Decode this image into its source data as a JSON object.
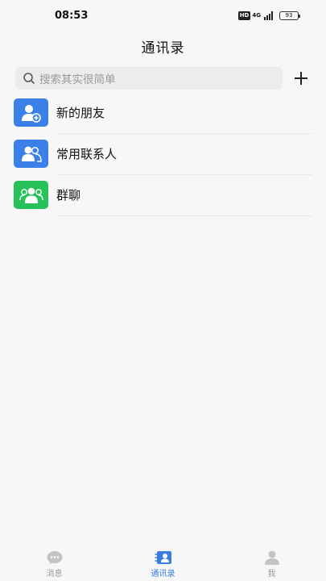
{
  "status_bar": {
    "time": "08:53",
    "hd_badge": "HD",
    "network": "4G",
    "battery": "93"
  },
  "header": {
    "title": "通讯录"
  },
  "search": {
    "placeholder": "搜索其实很简单",
    "add_icon": "plus-icon"
  },
  "contacts": {
    "items": [
      {
        "label": "新的朋友",
        "icon": "new-friend-icon",
        "color": "#3b7fe8"
      },
      {
        "label": "常用联系人",
        "icon": "frequent-contacts-icon",
        "color": "#3b7fe8"
      },
      {
        "label": "群聊",
        "icon": "group-chat-icon",
        "color": "#27c15a"
      }
    ]
  },
  "tab_bar": {
    "tabs": [
      {
        "label": "消息",
        "icon": "chat-bubble-icon",
        "active": false
      },
      {
        "label": "通讯录",
        "icon": "contacts-icon",
        "active": true
      },
      {
        "label": "我",
        "icon": "profile-icon",
        "active": false
      }
    ],
    "active_color": "#3a7de0",
    "inactive_color": "#c4c4c4"
  }
}
